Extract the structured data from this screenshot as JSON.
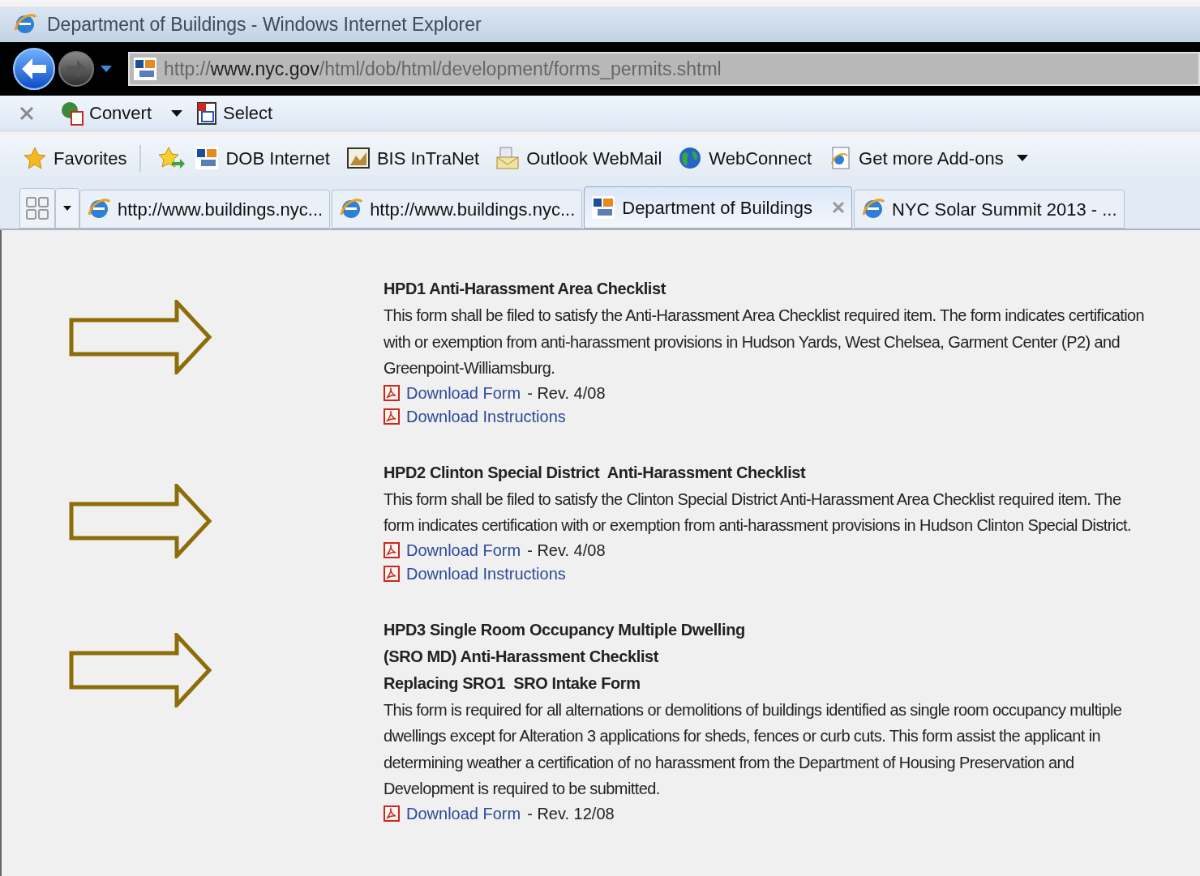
{
  "window": {
    "title": "Department of Buildings - Windows Internet Explorer"
  },
  "address": {
    "scheme": "http://",
    "host": "www.nyc.gov",
    "path": "/html/dob/html/development/forms_permits.shtml"
  },
  "command_bar": [
    {
      "label": "Convert",
      "kind": "convert",
      "dropdown": true
    },
    {
      "label": "Select",
      "kind": "select",
      "dropdown": false
    }
  ],
  "favorites_bar": {
    "label": "Favorites",
    "items": [
      {
        "label": "DOB Internet",
        "kind": "nyc"
      },
      {
        "label": "BIS InTraNet",
        "kind": "image"
      },
      {
        "label": "Outlook WebMail",
        "kind": "mail"
      },
      {
        "label": "WebConnect",
        "kind": "globe"
      },
      {
        "label": "Get more Add-ons",
        "kind": "page",
        "dropdown": true
      }
    ]
  },
  "tabs": [
    {
      "label": "http://www.buildings.nyc...",
      "kind": "ie",
      "selected": false
    },
    {
      "label": "http://www.buildings.nyc...",
      "kind": "ie",
      "selected": false
    },
    {
      "label": "Department of Buildings",
      "kind": "nyc",
      "selected": true
    },
    {
      "label": "NYC Solar Summit 2013 - ...",
      "kind": "ie",
      "selected": false
    }
  ],
  "forms": [
    {
      "title": [
        "HPD1 Anti-Harassment Area Checklist"
      ],
      "description": "This form shall be filed to satisfy the Anti-Harassment Area Checklist required item. The form indicates certification with or exemption from anti-harassment provisions in Hudson Yards, West Chelsea, Garment Center (P2) and Greenpoint-Williamsburg.",
      "links": [
        {
          "label": "Download Form",
          "note": "- Rev. 4/08"
        },
        {
          "label": "Download Instructions"
        }
      ]
    },
    {
      "title": [
        "HPD2 Clinton Special District  Anti-Harassment Checklist"
      ],
      "description": "This form shall be filed to satisfy the Clinton Special District Anti-Harassment Area Checklist required item. The form indicates certification with or exemption from anti-harassment provisions in Hudson Clinton Special District.",
      "links": [
        {
          "label": "Download Form",
          "note": "- Rev. 4/08"
        },
        {
          "label": "Download Instructions"
        }
      ]
    },
    {
      "title": [
        "HPD3 Single Room Occupancy Multiple Dwelling",
        "(SRO MD) Anti-Harassment Checklist",
        "Replacing SRO1  SRO Intake Form"
      ],
      "description": "This form is required for all alternations or demolitions of buildings identified as single room occupancy multiple dwellings except for Alteration 3 applications for sheds, fences or curb cuts. This form assist the applicant in determining weather a certification of no harassment from the Department of Housing Preservation and Development is required to be submitted.",
      "links": [
        {
          "label": "Download Form",
          "note": "- Rev. 12/08"
        }
      ]
    }
  ]
}
